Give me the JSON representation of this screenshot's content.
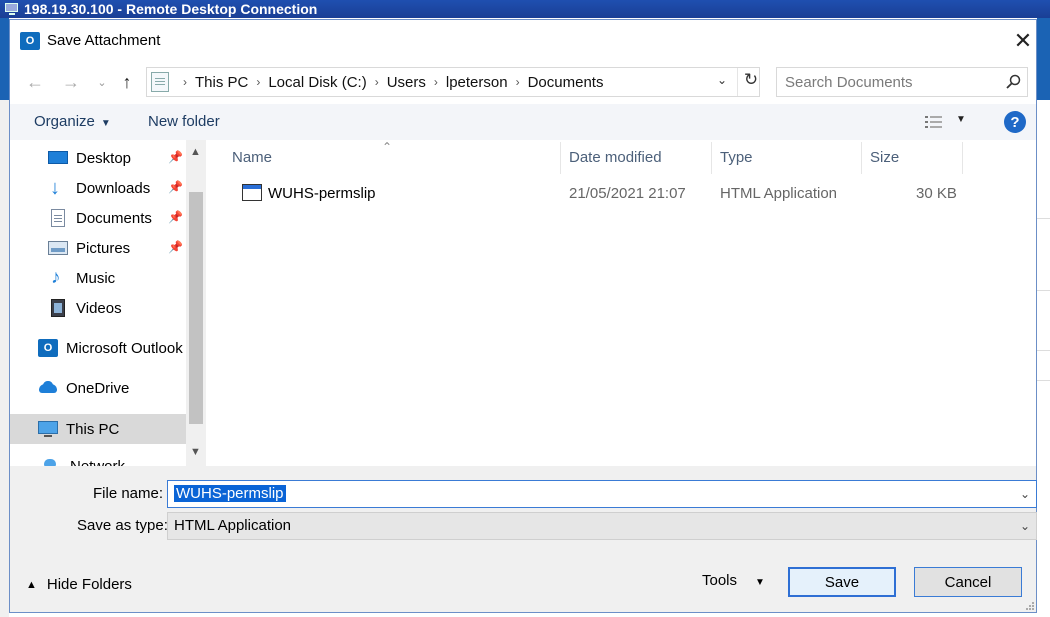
{
  "rdp": {
    "title": "198.19.30.100 - Remote Desktop Connection"
  },
  "dialog": {
    "title": "Save Attachment",
    "close_glyph": "✕"
  },
  "nav": {
    "breadcrumbs": [
      "This PC",
      "Local Disk (C:)",
      "Users",
      "lpeterson",
      "Documents"
    ],
    "search_placeholder": "Search Documents"
  },
  "toolbar": {
    "organize_label": "Organize",
    "new_folder_label": "New folder",
    "help_label": "?"
  },
  "sidebar": {
    "items": [
      {
        "label": "Desktop",
        "pinned": true,
        "icon": "desktop-icon"
      },
      {
        "label": "Downloads",
        "pinned": true,
        "icon": "download-icon"
      },
      {
        "label": "Documents",
        "pinned": true,
        "icon": "documents-icon"
      },
      {
        "label": "Pictures",
        "pinned": true,
        "icon": "pictures-icon"
      },
      {
        "label": "Music",
        "pinned": false,
        "icon": "music-icon"
      },
      {
        "label": "Videos",
        "pinned": false,
        "icon": "videos-icon"
      },
      {
        "label": "Microsoft Outlook",
        "pinned": false,
        "icon": "outlook-icon"
      },
      {
        "label": "OneDrive",
        "pinned": false,
        "icon": "onedrive-icon"
      },
      {
        "label": "This PC",
        "pinned": false,
        "icon": "computer-icon",
        "selected": true
      },
      {
        "label": "Network",
        "pinned": false,
        "icon": "network-icon"
      }
    ]
  },
  "columns": {
    "name": "Name",
    "date": "Date modified",
    "type": "Type",
    "size": "Size"
  },
  "files": [
    {
      "name": "WUHS-permslip",
      "date": "21/05/2021 21:07",
      "type": "HTML Application",
      "size": "30 KB"
    }
  ],
  "form": {
    "file_name_label": "File name:",
    "file_name_value": "WUHS-permslip",
    "save_type_label": "Save as type:",
    "save_type_value": "HTML Application"
  },
  "footer": {
    "hide_folders_label": "Hide Folders",
    "tools_label": "Tools",
    "save_label": "Save",
    "cancel_label": "Cancel"
  },
  "colors": {
    "accent": "#0a64d6",
    "help": "#1f69c7",
    "rdp_bar": "#1a3f95"
  }
}
